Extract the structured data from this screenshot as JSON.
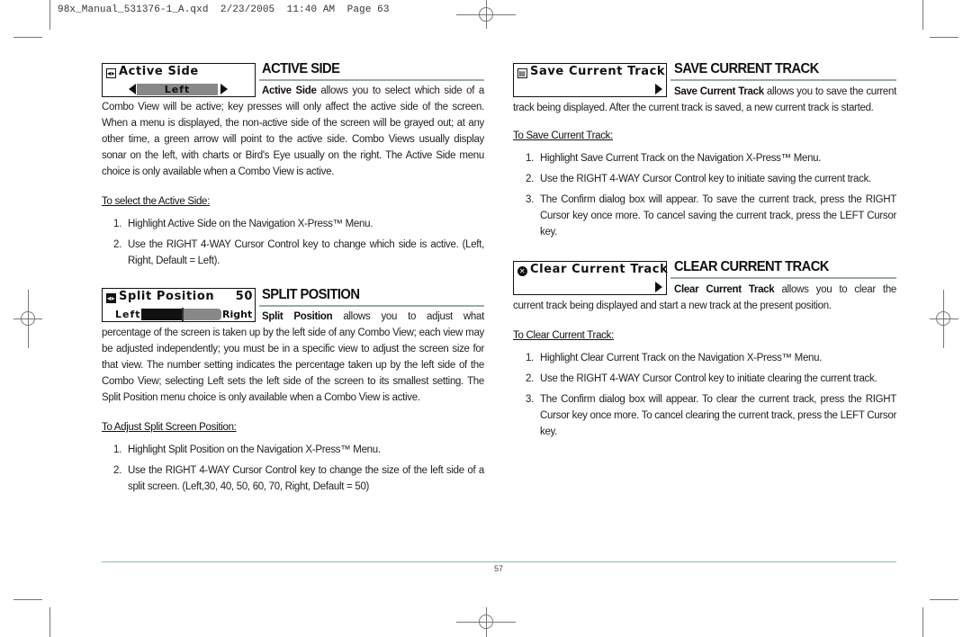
{
  "slug": "98x_Manual_531376-1_A.qxd  2/23/2005  11:40 AM  Page 63",
  "page_number": "57",
  "sections": {
    "active_side": {
      "menu": {
        "title": "Active Side",
        "icon": "split-arrows-icon",
        "value": "Left"
      },
      "heading": "ACTIVE SIDE",
      "lead_bold": "Active Side",
      "lead_rest": " allows you to select which side of a Combo View will be active; key presses will only affect the active side of the screen. When a menu is displayed, the non-active side of the screen will be grayed out; at any other time, a green arrow will point to the active side. Combo Views usually display sonar on the left, with charts or Bird's Eye usually on the right. The Active Side menu choice is only available when a Combo View is active.",
      "subhead": "To select the Active Side:",
      "steps": [
        {
          "num": "1.",
          "text": "Highlight Active Side on the Navigation X-Press™ Menu."
        },
        {
          "num": "2.",
          "text": "Use the RIGHT 4-WAY Cursor Control key to change which side is active. (Left, Right, Default = Left)."
        }
      ]
    },
    "split_position": {
      "menu": {
        "title": "Split Position",
        "icon": "split-arrows-icon",
        "value": "50",
        "left_label": "Left",
        "right_label": "Right",
        "slider_fraction": 0.5
      },
      "heading": "SPLIT POSITION",
      "lead_bold": "Split Position",
      "lead_rest": " allows you to adjust what percentage of the screen is taken up by the left side of any Combo View; each view may be adjusted independently; you must be in a specific view to adjust the screen size for that view. The number setting indicates the percentage taken up by the left side of the Combo View; selecting Left sets the left side of the screen to its smallest setting. The Split Position menu choice is only available when a Combo View is active.",
      "subhead": "To Adjust Split Screen Position:",
      "steps": [
        {
          "num": "1.",
          "text": "Highlight Split Position on the Navigation X-Press™ Menu."
        },
        {
          "num": "2.",
          "text": "Use the RIGHT 4-WAY Cursor Control key to change the size of the left side of a split screen. (Left,30, 40, 50, 60, 70, Right, Default = 50)"
        }
      ]
    },
    "save_track": {
      "menu": {
        "title": "Save Current Track",
        "icon": "save-disk-icon"
      },
      "heading": "SAVE CURRENT TRACK",
      "lead_bold": "Save Current Track",
      "lead_rest": " allows you to save the current track being displayed. After the current track is saved, a new current track is started.",
      "subhead": "To Save Current Track:",
      "steps": [
        {
          "num": "1.",
          "text": "Highlight Save Current Track on the Navigation X-Press™ Menu."
        },
        {
          "num": "2.",
          "text": "Use the RIGHT 4-WAY Cursor Control key to initiate saving the current track."
        },
        {
          "num": "3.",
          "text": "The Confirm dialog box will appear. To save the current track, press the RIGHT Cursor key once more. To cancel saving the current track, press the LEFT Cursor key."
        }
      ]
    },
    "clear_track": {
      "menu": {
        "title": "Clear Current Track",
        "icon": "clear-x-icon"
      },
      "heading": "CLEAR CURRENT TRACK",
      "lead_bold": "Clear Current Track",
      "lead_rest": " allows you to clear the current track being displayed and start a new track at the present position.",
      "subhead": "To Clear Current Track:",
      "steps": [
        {
          "num": "1.",
          "text": "Highlight Clear Current Track on the Navigation X-Press™ Menu."
        },
        {
          "num": "2.",
          "text": "Use the RIGHT 4-WAY Cursor Control key to initiate clearing the current track."
        },
        {
          "num": "3.",
          "text": "The Confirm dialog box will appear. To clear the current track, press the RIGHT Cursor key once more. To cancel clearing the current track, press the LEFT Cursor key."
        }
      ]
    }
  }
}
